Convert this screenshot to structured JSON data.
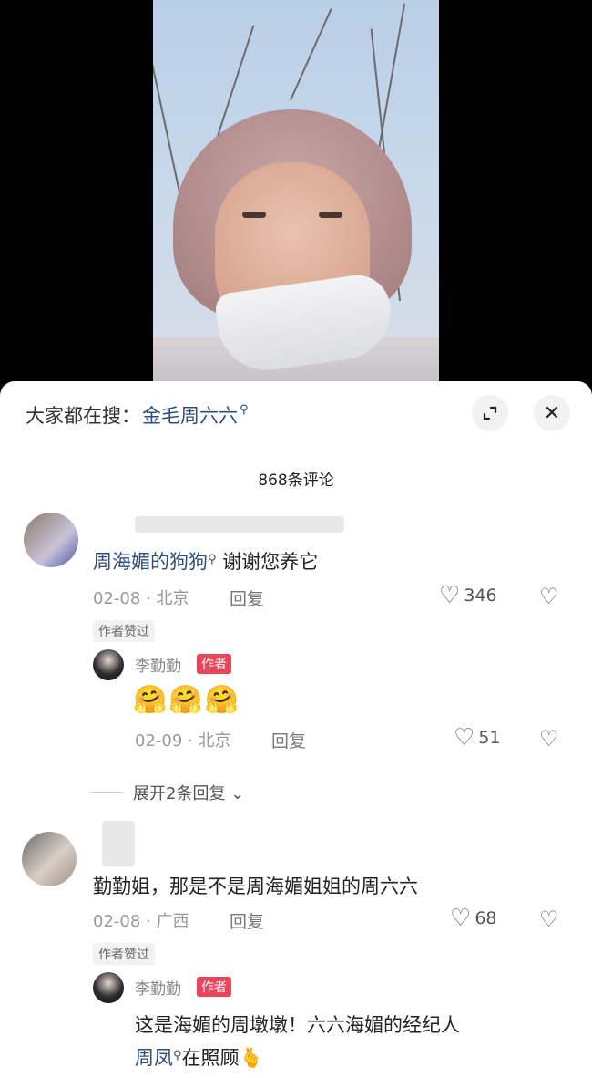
{
  "search": {
    "prefix": "大家都在搜：",
    "term": "金毛周六六"
  },
  "header": {
    "comment_count": "868条评论"
  },
  "comments": [
    {
      "body_link": "周海媚的狗狗",
      "body_text": " 谢谢您养它",
      "date": "02-08",
      "location": "北京",
      "reply_label": "回复",
      "likes": "346",
      "author_liked": "作者赞过",
      "reply": {
        "name": "李勤勤",
        "tag": "作者",
        "emojis": [
          "🤗",
          "🤗",
          "🤗"
        ],
        "date": "02-09",
        "location": "北京",
        "reply_label": "回复",
        "likes": "51"
      },
      "expand_label": "展开2条回复"
    },
    {
      "body_text": "勤勤姐，那是不是周海媚姐姐的周六六",
      "date": "02-08",
      "location": "广西",
      "reply_label": "回复",
      "likes": "68",
      "author_liked": "作者赞过",
      "reply": {
        "name": "李勤勤",
        "tag": "作者",
        "line1": "这是海媚的周墩墩！六六海媚的经纪人",
        "line2_link": "周凤",
        "line2_text": "在照顾",
        "line2_emoji": "🫰"
      }
    }
  ],
  "colors": {
    "accent_link": "#2f4d7a",
    "author_tag": "#e8455b"
  }
}
